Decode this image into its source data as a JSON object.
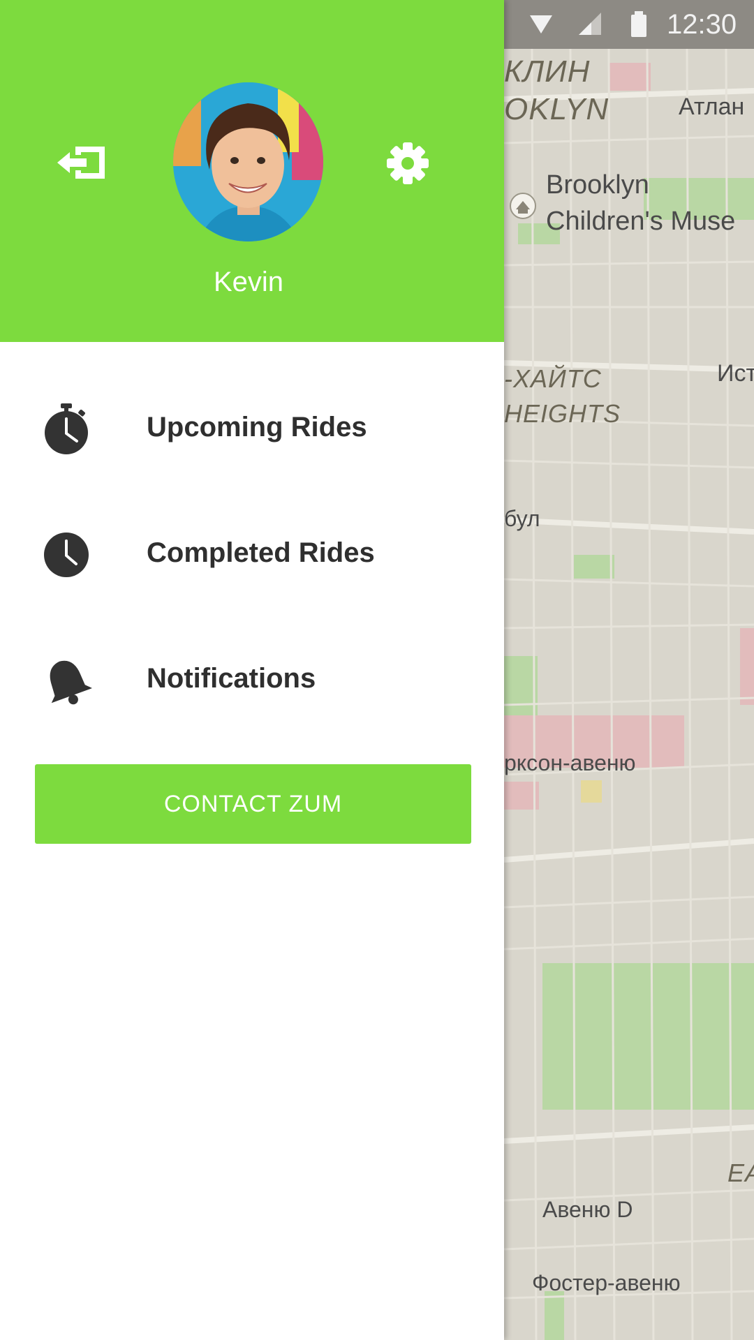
{
  "status_bar": {
    "time": "12:30"
  },
  "drawer": {
    "user_name": "Kevin",
    "menu": [
      {
        "label": "Upcoming Rides",
        "icon": "stopwatch-icon"
      },
      {
        "label": "Completed Rides",
        "icon": "clock-icon"
      },
      {
        "label": "Notifications",
        "icon": "bell-icon"
      }
    ],
    "contact_button": "CONTACT ZUM"
  },
  "map": {
    "labels": {
      "brooklyn_ru": "КЛИН",
      "brooklyn_en": "OKLYN",
      "atlantic": "Атлан",
      "museum_line1": "Brooklyn",
      "museum_line2": "Children's Muse",
      "heights_ru": "-ХАЙТС",
      "heights_en": "HEIGHTS",
      "east_road": "Ист",
      "street_ul": "бул",
      "parkson": "рксон-авеню",
      "ea": "EA",
      "avenue_d": "Авеню D",
      "foster": "Фостер-авеню"
    }
  },
  "colors": {
    "accent": "#7ddb3e",
    "text": "#2f2f2f",
    "map_bg": "#d9d6cc"
  }
}
